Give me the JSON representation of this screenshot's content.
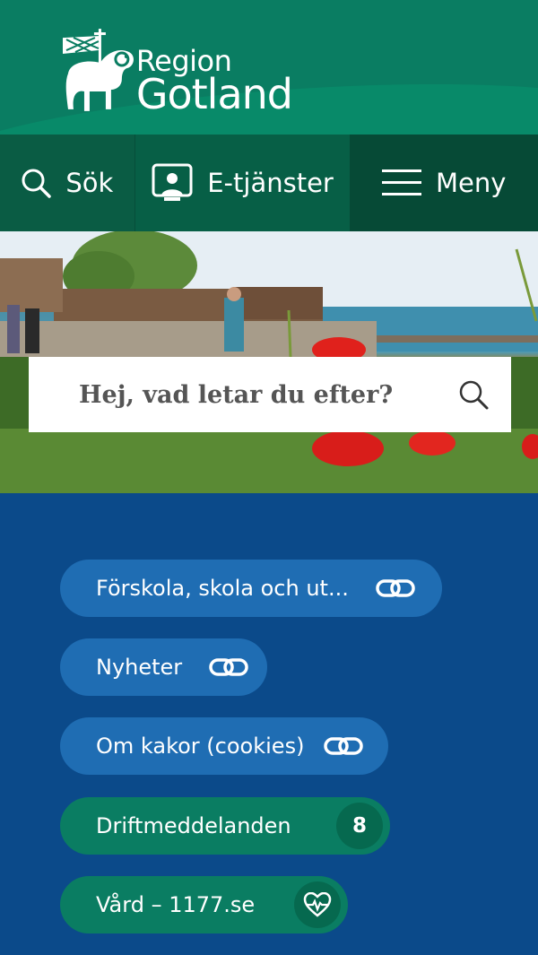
{
  "header": {
    "logo_line1": "Region",
    "logo_line2": "Gotland"
  },
  "nav": {
    "search_label": "Sök",
    "eservices_label": "E-tjänster",
    "menu_label": "Meny"
  },
  "search": {
    "placeholder": "Hej, vad letar du efter?"
  },
  "quicklinks": [
    {
      "label": "Förskola, skola och ut...",
      "icon": "link-icon"
    },
    {
      "label": "Nyheter",
      "icon": "link-icon"
    },
    {
      "label": "Om kakor (cookies)",
      "icon": "link-icon"
    },
    {
      "label": "Driftmeddelanden",
      "badge": "8"
    },
    {
      "label": "Vård – 1177.se",
      "icon": "heart-pulse-icon"
    }
  ],
  "colors": {
    "brand_green": "#0a7d62",
    "nav_dark_green": "#064a36",
    "links_background": "#0b4a8a",
    "pill_blue": "#1f6db3"
  }
}
